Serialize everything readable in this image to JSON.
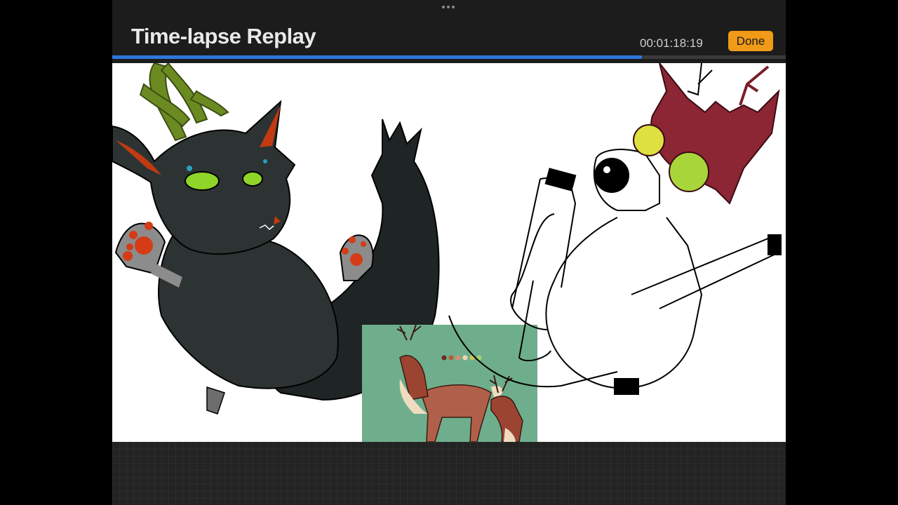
{
  "header": {
    "title": "Time-lapse Replay",
    "timecode": "00:01:18:19",
    "done_label": "Done"
  },
  "playback": {
    "progress": 0.786
  },
  "colors": {
    "accent_orange": "#f09a18",
    "progress_blue": "#2f77d8",
    "background": "#1c1c1c"
  },
  "icons": {
    "drag_handle": "ellipsis-icon"
  }
}
